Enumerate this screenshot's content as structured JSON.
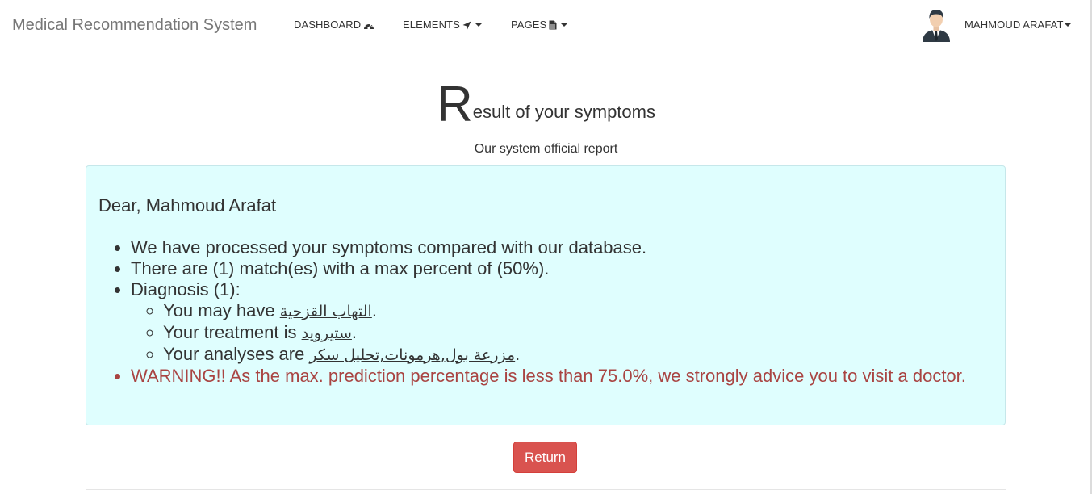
{
  "navbar": {
    "brand": "Medical Recommendation System",
    "items": [
      {
        "label": "DASHBOARD",
        "icon": "dashboard-icon",
        "has_dropdown": false
      },
      {
        "label": "ELEMENTS",
        "icon": "send-icon",
        "has_dropdown": true
      },
      {
        "label": "PAGES",
        "icon": "file-icon",
        "has_dropdown": true
      }
    ],
    "user": {
      "name": "MAHMOUD ARAFAT",
      "avatar_icon": "user-avatar-icon"
    }
  },
  "heading": {
    "initial": "R",
    "rest": "esult of your symptoms",
    "subtitle": "Our system official report"
  },
  "report": {
    "greeting": "Dear, Mahmoud Arafat",
    "lines": [
      "We have processed your symptoms compared with our database.",
      "There are (1) match(es) with a max percent of (50%).",
      "Diagnosis (1):"
    ],
    "diagnosis": {
      "disease_prefix": "You may have ",
      "disease": "التهاب القزحية",
      "treatment_prefix": "Your treatment is ",
      "treatment": "ستيرويد",
      "analyses_prefix": "Your analyses are ",
      "analyses": "مزرعة بول,هرمونات,تحليل سكر",
      "suffix": "."
    },
    "warning": "WARNING!! As the max. prediction percentage is less than 75.0%, we strongly advice you to visit a doctor."
  },
  "actions": {
    "return_label": "Return"
  },
  "colors": {
    "report_background": "#dffefe",
    "warning_text": "#a94442",
    "return_button": "#d9534f"
  }
}
